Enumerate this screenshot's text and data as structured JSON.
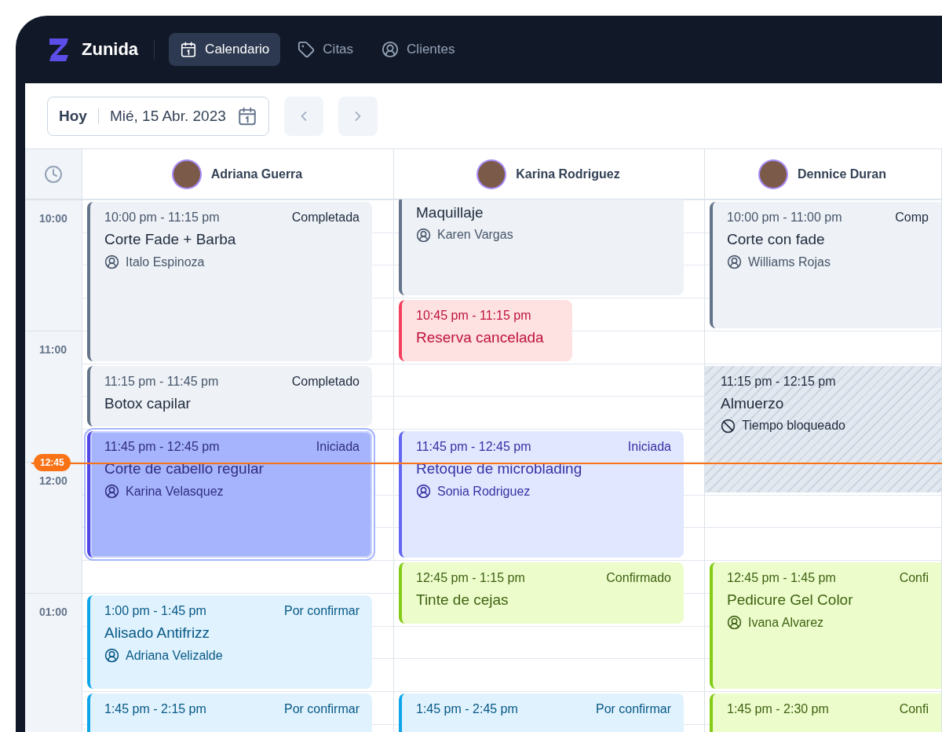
{
  "app": {
    "name": "Zunida"
  },
  "nav": [
    {
      "kind": "calendar",
      "label": "Calendario",
      "selected": true
    },
    {
      "kind": "tag",
      "label": "Citas",
      "selected": false
    },
    {
      "kind": "user",
      "label": "Clientes",
      "selected": false
    }
  ],
  "toolbar": {
    "today": "Hoy",
    "date": "Mié, 15 Abr. 2023"
  },
  "time_slots": [
    "10:00",
    "11:00",
    "12:00",
    "01:00"
  ],
  "now": {
    "label": "12:45"
  },
  "staff": [
    {
      "name": "Adriana Guerra",
      "events": [
        {
          "kind": "completed",
          "selected": false,
          "time": "10:00 pm - 11:15 pm",
          "status": "Completada",
          "title": "Corte Fade + Barba",
          "client": "Italo Espinoza"
        },
        {
          "kind": "completed",
          "selected": false,
          "time": "11:15 pm - 11:45 pm",
          "status": "Completado",
          "title": "Botox capilar"
        },
        {
          "kind": "started",
          "selected": true,
          "time": "11:45 pm - 12:45 pm",
          "status": "Iniciada",
          "title": "Corte de cabello regular",
          "client": "Karina Velasquez"
        },
        {
          "kind": "pending",
          "selected": false,
          "time": "1:00 pm - 1:45 pm",
          "status": "Por confirmar",
          "title": "Alisado Antifrizz",
          "client": "Adriana Velizalde"
        },
        {
          "kind": "pending",
          "selected": false,
          "time": "1:45 pm - 2:15 pm",
          "status": "Por confirmar"
        }
      ]
    },
    {
      "name": "Karina Rodriguez",
      "events": [
        {
          "kind": "completed",
          "selected": false,
          "title": "Maquillaje",
          "client": "Karen Vargas"
        },
        {
          "kind": "cancelled",
          "selected": false,
          "time": "10:45 pm - 11:15 pm",
          "title": "Reserva cancelada"
        },
        {
          "kind": "started",
          "selected": false,
          "time": "11:45 pm - 12:45 pm",
          "status": "Iniciada",
          "title": "Retoque de microblading",
          "client": "Sonia Rodriguez"
        },
        {
          "kind": "confirmed",
          "selected": false,
          "time": "12:45 pm - 1:15 pm",
          "status": "Confirmado",
          "title": "Tinte de cejas"
        },
        {
          "kind": "pending",
          "selected": false,
          "time": "1:45 pm - 2:45 pm",
          "status": "Por confirmar"
        }
      ]
    },
    {
      "name": "Dennice Duran",
      "events": [
        {
          "kind": "completed",
          "selected": false,
          "time": "10:00 pm - 11:00 pm",
          "status": "Comp",
          "title": "Corte con fade",
          "client": "Williams Rojas"
        },
        {
          "kind": "blocked",
          "selected": false,
          "time": "11:15 pm - 12:15 pm",
          "title": "Almuerzo",
          "note": "Tiempo bloqueado"
        },
        {
          "kind": "confirmed",
          "selected": false,
          "time": "12:45 pm - 1:45 pm",
          "status": "Confi",
          "title": "Pedicure Gel Color",
          "client": "Ivana Alvarez"
        },
        {
          "kind": "confirmed",
          "selected": false,
          "time": "1:45 pm - 2:30 pm",
          "status": "Confi"
        }
      ]
    }
  ]
}
